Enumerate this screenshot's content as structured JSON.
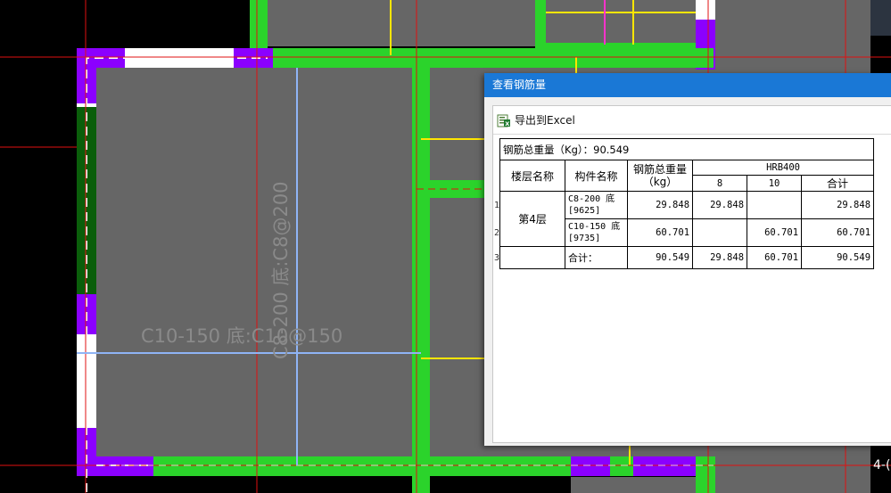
{
  "canvas": {
    "slab_labels": [
      {
        "text": "C10-150 底:C10@150"
      },
      {
        "text": "C8-200 底:C8@200"
      }
    ],
    "corner_label": "4-("
  },
  "dialog": {
    "title": "查看钢筋量",
    "export_label": "导出到Excel",
    "total_weight_label": "钢筋总重量（Kg）：90.549",
    "headers": {
      "floor": "楼层名称",
      "component": "构件名称",
      "total": "钢筋总重量\n（kg）",
      "grade": "HRB400",
      "sub": [
        "8",
        "10",
        "合计"
      ]
    },
    "rows": [
      {
        "num": "1",
        "floor": "第4层",
        "component": "C8-200 底[9625]",
        "total": "29.848",
        "d8": "29.848",
        "d10": "",
        "sum": "29.848"
      },
      {
        "num": "2",
        "component": "C10-150 底[9735]",
        "total": "60.701",
        "d8": "",
        "d10": "60.701",
        "sum": "60.701"
      },
      {
        "num": "3",
        "component": "合计：",
        "total": "90.549",
        "d8": "29.848",
        "d10": "60.701",
        "sum": "90.549"
      }
    ]
  }
}
